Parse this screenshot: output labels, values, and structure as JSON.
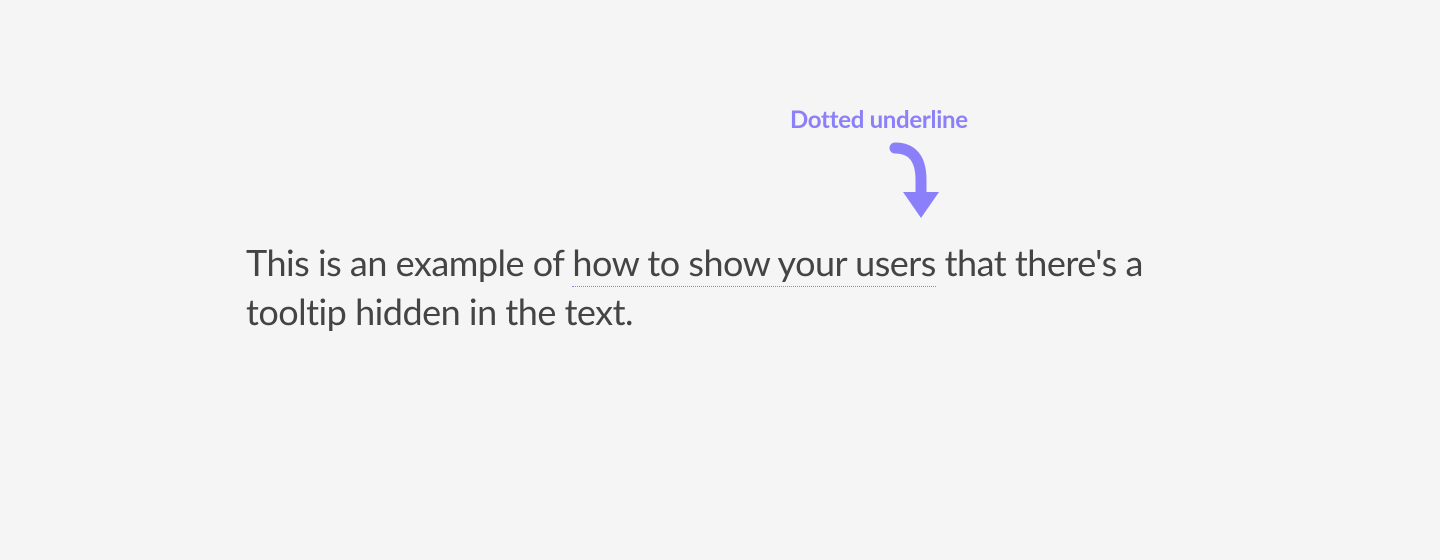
{
  "annotation": {
    "label": "Dotted underline"
  },
  "content": {
    "text_before": "This is an example of ",
    "tooltip_phrase": "how to show your users",
    "text_after": " that there's a tooltip hidden in the text."
  },
  "colors": {
    "accent": "#8b80f9",
    "text": "#444444",
    "background": "#f5f5f5"
  }
}
